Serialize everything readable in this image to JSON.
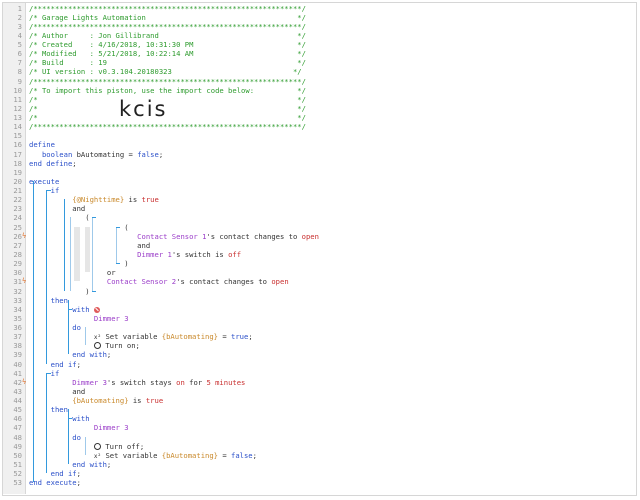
{
  "lines": [
    {
      "n": "1",
      "trigger": false,
      "parts": [
        {
          "cls": "c",
          "text": "/**************************************************************/"
        }
      ]
    },
    {
      "n": "2",
      "trigger": false,
      "parts": [
        {
          "cls": "c",
          "text": "/* Garage Lights Automation                                   */"
        }
      ]
    },
    {
      "n": "3",
      "trigger": false,
      "parts": [
        {
          "cls": "c",
          "text": "/**************************************************************/"
        }
      ]
    },
    {
      "n": "4",
      "trigger": false,
      "parts": [
        {
          "cls": "c",
          "text": "/* Author     : Jon Gillibrand                                */"
        }
      ]
    },
    {
      "n": "5",
      "trigger": false,
      "parts": [
        {
          "cls": "c",
          "text": "/* Created    : 4/16/2018, 10:31:30 PM                        */"
        }
      ]
    },
    {
      "n": "6",
      "trigger": false,
      "parts": [
        {
          "cls": "c",
          "text": "/* Modified   : 5/21/2018, 10:22:14 AM                        */"
        }
      ]
    },
    {
      "n": "7",
      "trigger": false,
      "parts": [
        {
          "cls": "c",
          "text": "/* Build      : 19                                            */"
        }
      ]
    },
    {
      "n": "8",
      "trigger": false,
      "parts": [
        {
          "cls": "c",
          "text": "/* UI version : v0.3.104.20180323                            */"
        }
      ]
    },
    {
      "n": "9",
      "trigger": false,
      "parts": [
        {
          "cls": "c",
          "text": "/**************************************************************/"
        }
      ]
    },
    {
      "n": "10",
      "trigger": false,
      "parts": [
        {
          "cls": "c",
          "text": "/* To import this piston, use the import code below:          */"
        }
      ]
    },
    {
      "n": "11",
      "trigger": false,
      "parts": [
        {
          "cls": "c",
          "text": "/*                                                            */"
        }
      ]
    },
    {
      "n": "12",
      "trigger": false,
      "parts": [
        {
          "cls": "c",
          "text": "/*                                                            */"
        }
      ]
    },
    {
      "n": "13",
      "trigger": false,
      "parts": [
        {
          "cls": "c",
          "text": "/*                                                            */"
        }
      ]
    },
    {
      "n": "14",
      "trigger": false,
      "parts": [
        {
          "cls": "c",
          "text": "/**************************************************************/"
        }
      ]
    },
    {
      "n": "15",
      "trigger": false,
      "parts": []
    },
    {
      "n": "16",
      "trigger": false,
      "parts": [
        {
          "cls": "k",
          "text": "define"
        }
      ]
    },
    {
      "n": "17",
      "trigger": false,
      "parts": [
        {
          "cls": "k",
          "text": "   boolean "
        },
        {
          "cls": "t",
          "text": "bAutomating = "
        },
        {
          "cls": "k",
          "text": "false"
        },
        {
          "cls": "t",
          "text": ";"
        }
      ]
    },
    {
      "n": "18",
      "trigger": false,
      "parts": [
        {
          "cls": "k",
          "text": "end define"
        },
        {
          "cls": "t",
          "text": ";"
        }
      ]
    },
    {
      "n": "19",
      "trigger": false,
      "parts": []
    },
    {
      "n": "20",
      "trigger": false,
      "parts": [
        {
          "cls": "k",
          "text": "execute"
        }
      ]
    },
    {
      "n": "21",
      "trigger": false,
      "parts": [
        {
          "cls": "k",
          "text": "     if"
        }
      ]
    },
    {
      "n": "22",
      "trigger": false,
      "parts": [
        {
          "cls": "v",
          "text": "          {@Nighttime}"
        },
        {
          "cls": "t",
          "text": " is "
        },
        {
          "cls": "o",
          "text": "true"
        }
      ]
    },
    {
      "n": "23",
      "trigger": false,
      "parts": [
        {
          "cls": "t",
          "text": "          and"
        }
      ]
    },
    {
      "n": "24",
      "trigger": false,
      "parts": [
        {
          "cls": "t",
          "text": "             ("
        }
      ]
    },
    {
      "n": "25",
      "trigger": false,
      "parts": [
        {
          "cls": "t",
          "text": "                      ("
        }
      ]
    },
    {
      "n": "26",
      "trigger": true,
      "parts": [
        {
          "cls": "d",
          "text": "                         Contact Sensor 1"
        },
        {
          "cls": "t",
          "text": "'s contact changes to "
        },
        {
          "cls": "o",
          "text": "open"
        }
      ]
    },
    {
      "n": "27",
      "trigger": false,
      "parts": [
        {
          "cls": "t",
          "text": "                         and"
        }
      ]
    },
    {
      "n": "28",
      "trigger": false,
      "parts": [
        {
          "cls": "d",
          "text": "                         Dimmer 1"
        },
        {
          "cls": "t",
          "text": "'s switch is "
        },
        {
          "cls": "o",
          "text": "off"
        }
      ]
    },
    {
      "n": "29",
      "trigger": false,
      "parts": [
        {
          "cls": "t",
          "text": "                      )"
        }
      ]
    },
    {
      "n": "30",
      "trigger": false,
      "parts": [
        {
          "cls": "t",
          "text": "                  or"
        }
      ]
    },
    {
      "n": "31",
      "trigger": true,
      "parts": [
        {
          "cls": "d",
          "text": "                  Contact Sensor 2"
        },
        {
          "cls": "t",
          "text": "'s contact changes to "
        },
        {
          "cls": "o",
          "text": "open"
        }
      ]
    },
    {
      "n": "32",
      "trigger": false,
      "parts": [
        {
          "cls": "t",
          "text": "             )"
        }
      ]
    },
    {
      "n": "33",
      "trigger": false,
      "parts": [
        {
          "cls": "k",
          "text": "     then"
        }
      ]
    },
    {
      "n": "34",
      "trigger": false,
      "parts": [
        {
          "cls": "k",
          "text": "          with "
        },
        {
          "cls": "icon",
          "text": "no"
        }
      ]
    },
    {
      "n": "35",
      "trigger": false,
      "parts": [
        {
          "cls": "d",
          "text": "               Dimmer 3"
        }
      ]
    },
    {
      "n": "36",
      "trigger": false,
      "parts": [
        {
          "cls": "k",
          "text": "          do"
        }
      ]
    },
    {
      "n": "37",
      "trigger": false,
      "parts": [
        {
          "cls": "t",
          "text": "               "
        },
        {
          "cls": "sup",
          "text": "x²"
        },
        {
          "cls": "t",
          "text": " Set variable "
        },
        {
          "cls": "v",
          "text": "{bAutomating}"
        },
        {
          "cls": "t",
          "text": " = "
        },
        {
          "cls": "k",
          "text": "true"
        },
        {
          "cls": "t",
          "text": ";"
        }
      ]
    },
    {
      "n": "38",
      "trigger": false,
      "parts": [
        {
          "cls": "t",
          "text": "               "
        },
        {
          "cls": "icon",
          "text": "pwr"
        },
        {
          "cls": "t",
          "text": " Turn on;"
        }
      ]
    },
    {
      "n": "39",
      "trigger": false,
      "parts": [
        {
          "cls": "k",
          "text": "          end with"
        },
        {
          "cls": "t",
          "text": ";"
        }
      ]
    },
    {
      "n": "40",
      "trigger": false,
      "parts": [
        {
          "cls": "k",
          "text": "     end if"
        },
        {
          "cls": "t",
          "text": ";"
        }
      ]
    },
    {
      "n": "41",
      "trigger": false,
      "parts": [
        {
          "cls": "k",
          "text": "     if"
        }
      ]
    },
    {
      "n": "42",
      "trigger": true,
      "parts": [
        {
          "cls": "d",
          "text": "          Dimmer 3"
        },
        {
          "cls": "t",
          "text": "'s switch stays "
        },
        {
          "cls": "o",
          "text": "on"
        },
        {
          "cls": "t",
          "text": " for "
        },
        {
          "cls": "o",
          "text": "5 minutes"
        }
      ]
    },
    {
      "n": "43",
      "trigger": false,
      "parts": [
        {
          "cls": "t",
          "text": "          and"
        }
      ]
    },
    {
      "n": "44",
      "trigger": false,
      "parts": [
        {
          "cls": "v",
          "text": "          {bAutomating}"
        },
        {
          "cls": "t",
          "text": " is "
        },
        {
          "cls": "o",
          "text": "true"
        }
      ]
    },
    {
      "n": "45",
      "trigger": false,
      "parts": [
        {
          "cls": "k",
          "text": "     then"
        }
      ]
    },
    {
      "n": "46",
      "trigger": false,
      "parts": [
        {
          "cls": "k",
          "text": "          with"
        }
      ]
    },
    {
      "n": "47",
      "trigger": false,
      "parts": [
        {
          "cls": "d",
          "text": "               Dimmer 3"
        }
      ]
    },
    {
      "n": "48",
      "trigger": false,
      "parts": [
        {
          "cls": "k",
          "text": "          do"
        }
      ]
    },
    {
      "n": "49",
      "trigger": false,
      "parts": [
        {
          "cls": "t",
          "text": "               "
        },
        {
          "cls": "icon",
          "text": "pwr"
        },
        {
          "cls": "t",
          "text": " Turn off;"
        }
      ]
    },
    {
      "n": "50",
      "trigger": false,
      "parts": [
        {
          "cls": "t",
          "text": "               "
        },
        {
          "cls": "sup",
          "text": "x²"
        },
        {
          "cls": "t",
          "text": " Set variable "
        },
        {
          "cls": "v",
          "text": "{bAutomating}"
        },
        {
          "cls": "t",
          "text": " = "
        },
        {
          "cls": "k",
          "text": "false"
        },
        {
          "cls": "t",
          "text": ";"
        }
      ]
    },
    {
      "n": "51",
      "trigger": false,
      "parts": [
        {
          "cls": "k",
          "text": "          end with"
        },
        {
          "cls": "t",
          "text": ";"
        }
      ]
    },
    {
      "n": "52",
      "trigger": false,
      "parts": [
        {
          "cls": "k",
          "text": "     end if"
        },
        {
          "cls": "t",
          "text": ";"
        }
      ]
    },
    {
      "n": "53",
      "trigger": false,
      "parts": [
        {
          "cls": "k",
          "text": "end execute"
        },
        {
          "cls": "t",
          "text": ";"
        }
      ]
    }
  ],
  "import_code": "kcis",
  "trigger_glyph": "ϟ"
}
